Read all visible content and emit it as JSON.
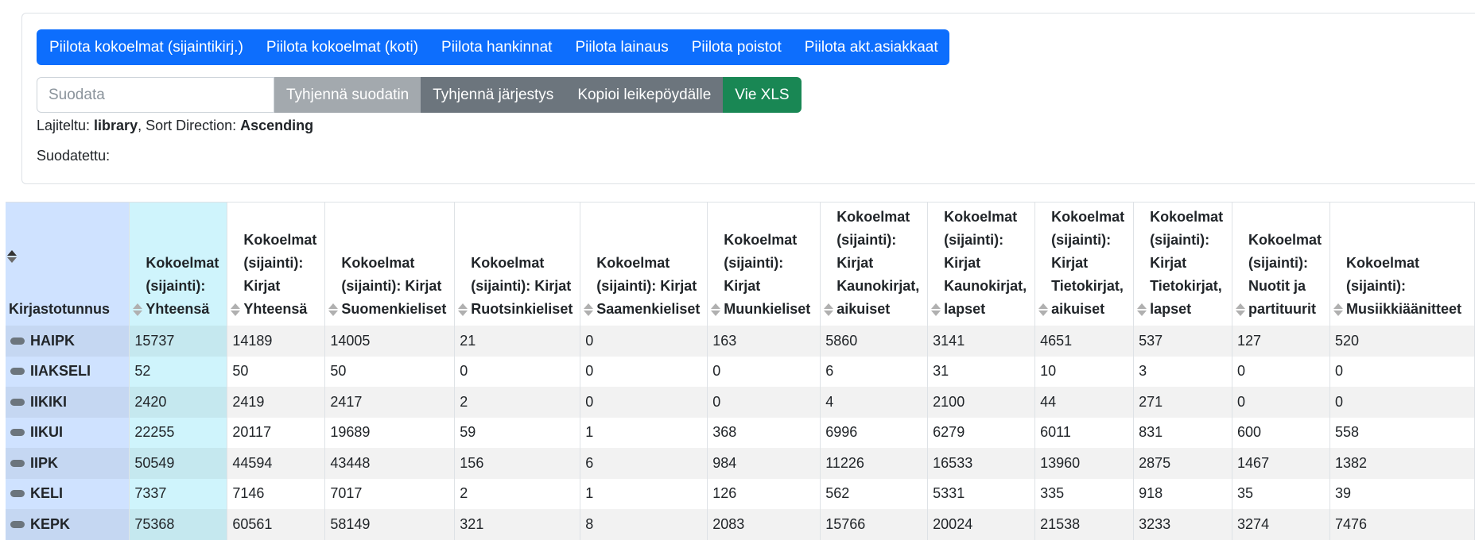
{
  "top_buttons": [
    {
      "label": "Piilota kokoelmat (sijaintikirj.)"
    },
    {
      "label": "Piilota kokoelmat (koti)"
    },
    {
      "label": "Piilota hankinnat"
    },
    {
      "label": "Piilota lainaus"
    },
    {
      "label": "Piilota poistot"
    },
    {
      "label": "Piilota akt.asiakkaat"
    }
  ],
  "filter": {
    "placeholder": "Suodata",
    "value": "",
    "clear_filter_label": "Tyhjennä suodatin",
    "clear_sort_label": "Tyhjennä järjestys",
    "copy_label": "Kopioi leikepöydälle",
    "export_label": "Vie XLS"
  },
  "status": {
    "sorted_prefix": "Lajiteltu: ",
    "sorted_field": "library",
    "direction_prefix": ", Sort Direction: ",
    "direction_value": "Ascending",
    "filtered_label": "Suodatettu:"
  },
  "table": {
    "columns": [
      "Kirjastotunnus",
      "Kokoelmat (sijainti): Yhteensä",
      "Kokoelmat (sijainti): Kirjat Yhteensä",
      "Kokoelmat (sijainti): Kirjat Suomenkieliset",
      "Kokoelmat (sijainti): Kirjat Ruotsinkieliset",
      "Kokoelmat (sijainti): Kirjat Saamenkieliset",
      "Kokoelmat (sijainti): Kirjat Muunkieliset",
      "Kokoelmat (sijainti): Kirjat Kaunokirjat, aikuiset",
      "Kokoelmat (sijainti): Kirjat Kaunokirjat, lapset",
      "Kokoelmat (sijainti): Kirjat Tietokirjat, aikuiset",
      "Kokoelmat (sijainti): Kirjat Tietokirjat, lapset",
      "Kokoelmat (sijainti): Nuotit ja partituurit",
      "Kokoelmat (sijainti): Musiikkiäänitteet"
    ],
    "rows": [
      [
        "HAIPK",
        "15737",
        "14189",
        "14005",
        "21",
        "0",
        "163",
        "5860",
        "3141",
        "4651",
        "537",
        "127",
        "520"
      ],
      [
        "IIAKSELI",
        "52",
        "50",
        "50",
        "0",
        "0",
        "0",
        "6",
        "31",
        "10",
        "3",
        "0",
        "0"
      ],
      [
        "IIKIKI",
        "2420",
        "2419",
        "2417",
        "2",
        "0",
        "0",
        "4",
        "2100",
        "44",
        "271",
        "0",
        "0"
      ],
      [
        "IIKUI",
        "22255",
        "20117",
        "19689",
        "59",
        "1",
        "368",
        "6996",
        "6279",
        "6011",
        "831",
        "600",
        "558"
      ],
      [
        "IIPK",
        "50549",
        "44594",
        "43448",
        "156",
        "6",
        "984",
        "11226",
        "16533",
        "13960",
        "2875",
        "1467",
        "1382"
      ],
      [
        "KELI",
        "7337",
        "7146",
        "7017",
        "2",
        "1",
        "126",
        "562",
        "5331",
        "335",
        "918",
        "35",
        "39"
      ],
      [
        "KEPK",
        "75368",
        "60561",
        "58149",
        "321",
        "8",
        "2083",
        "15766",
        "20024",
        "21538",
        "3233",
        "3274",
        "7476"
      ]
    ]
  },
  "colors": {
    "primary": "#0d6efd",
    "secondary": "#6c757d",
    "success": "#198754",
    "sorted_column_bg": "#cfe2ff",
    "info_column_bg": "#cff4fc"
  }
}
